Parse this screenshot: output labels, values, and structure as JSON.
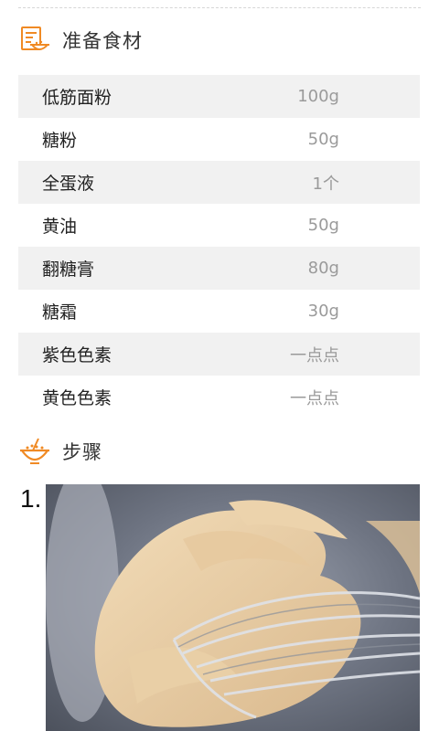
{
  "ingredients_section": {
    "title": "准备食材",
    "icon": "recipe-card-icon",
    "items": [
      {
        "name": "低筋面粉",
        "amount": "100g"
      },
      {
        "name": "糖粉",
        "amount": "50g"
      },
      {
        "name": "全蛋液",
        "amount": "1个"
      },
      {
        "name": "黄油",
        "amount": "50g"
      },
      {
        "name": "翻糖膏",
        "amount": "80g"
      },
      {
        "name": "糖霜",
        "amount": "30g"
      },
      {
        "name": "紫色色素",
        "amount": "一点点"
      },
      {
        "name": "黄色色素",
        "amount": "一点点"
      }
    ]
  },
  "steps_section": {
    "title": "步骤",
    "icon": "mixing-bowl-icon",
    "steps": [
      {
        "number": "1.",
        "image": "butter-whisk-photo"
      }
    ]
  },
  "colors": {
    "accent": "#f08a24",
    "row_alt_bg": "#f1f1f1",
    "amount_text": "#9a9a9a"
  }
}
